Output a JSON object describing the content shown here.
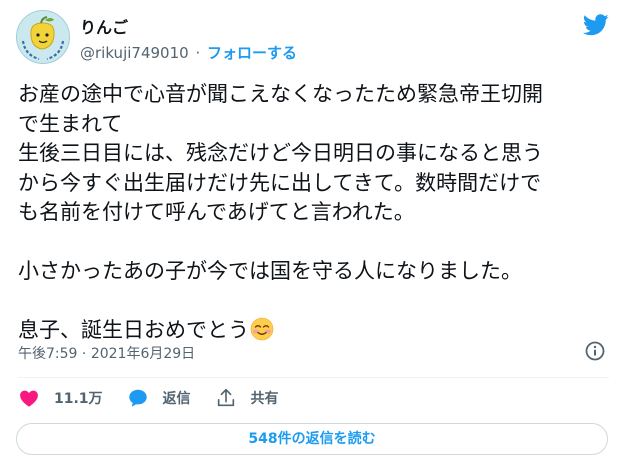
{
  "author": {
    "name": "りんご",
    "handle": "@rikuji749010",
    "separator": "·",
    "follow_label": "フォローする",
    "avatar_text": "毎日のほっこりをお届け"
  },
  "tweet": {
    "lines": [
      "お産の途中で心音が聞こえなくなったため緊急帝王切開",
      "で生まれて",
      "生後三日目には、残念だけど今日明日の事になると思う",
      "から今すぐ出生届けだけ先に出してきて。数時間だけで",
      "も名前を付けて呼んであげてと言われた。",
      "",
      "小さかったあの子が今では国を守る人になりました。",
      "",
      "息子、誕生日おめでとう"
    ],
    "emoji": "smiling-face-with-blush-icon"
  },
  "meta": {
    "time": "午後7:59",
    "separator": "·",
    "date": "2021年6月29日"
  },
  "actions": {
    "like_count": "11.1万",
    "reply_label": "返信",
    "share_label": "共有"
  },
  "replies_button": "548件の返信を読む",
  "colors": {
    "accent": "#1d9bf0",
    "like": "#f91880",
    "muted": "#536471",
    "text": "#0f1419",
    "border": "#cfd9de"
  }
}
